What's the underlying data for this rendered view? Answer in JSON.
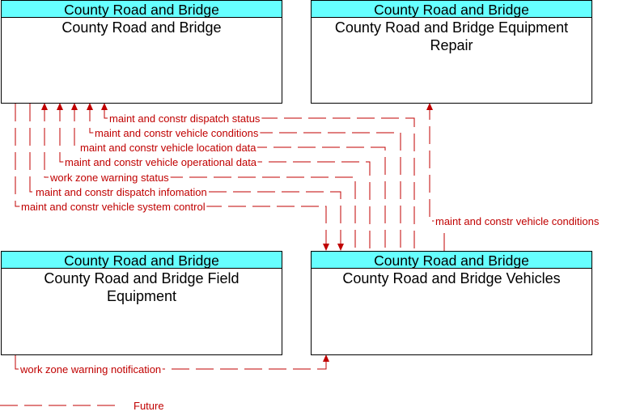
{
  "elements": {
    "crb": {
      "header": "County Road and Bridge",
      "name": "County Road and Bridge"
    },
    "repair": {
      "header": "County Road and Bridge",
      "name_line1": "County Road and Bridge Equipment",
      "name_line2": "Repair"
    },
    "field": {
      "header": "County Road and Bridge",
      "name_line1": "County Road and Bridge Field",
      "name_line2": "Equipment"
    },
    "vehicles": {
      "header": "County Road and Bridge",
      "name": "County Road and Bridge Vehicles"
    }
  },
  "flows": [
    {
      "label": "maint and constr dispatch status",
      "status": "Future"
    },
    {
      "label": "maint and constr vehicle conditions",
      "status": "Future"
    },
    {
      "label": "maint and constr vehicle location data",
      "status": "Future"
    },
    {
      "label": "maint and constr vehicle operational data",
      "status": "Future"
    },
    {
      "label": "work zone warning status",
      "status": "Future"
    },
    {
      "label": "maint and constr dispatch infomation",
      "status": "Future"
    },
    {
      "label": "maint and constr vehicle system control",
      "status": "Future"
    },
    {
      "label": "maint and constr vehicle conditions",
      "status": "Future"
    },
    {
      "label": "work zone warning notification",
      "status": "Future"
    }
  ],
  "legend": {
    "future_label": "Future"
  },
  "colors": {
    "flow": "#c00000",
    "header": "#66ffff"
  }
}
